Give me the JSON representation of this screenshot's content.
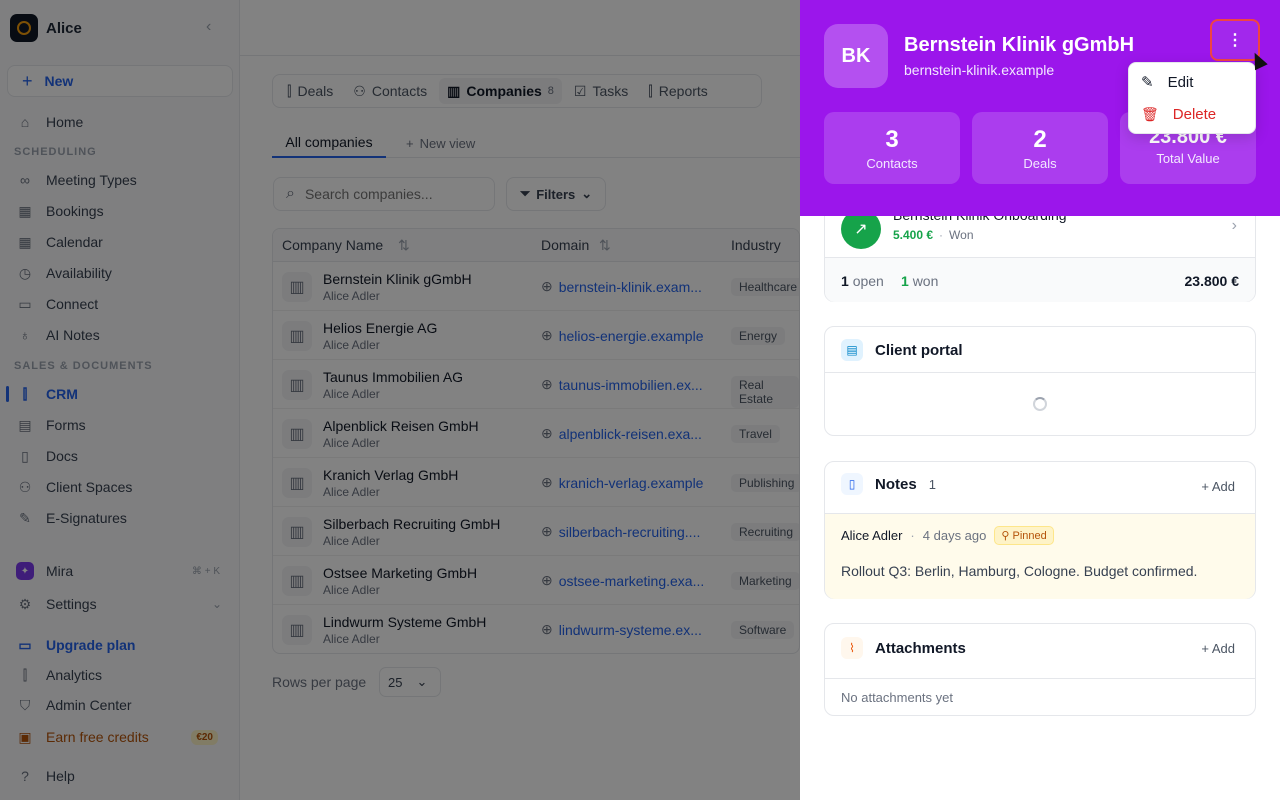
{
  "sidebar": {
    "workspace": "Alice",
    "new_label": "New",
    "items": [
      {
        "label": "Home"
      },
      {
        "label": "Meeting Types"
      },
      {
        "label": "Bookings"
      },
      {
        "label": "Calendar"
      },
      {
        "label": "Availability"
      },
      {
        "label": "Connect"
      },
      {
        "label": "AI Notes"
      },
      {
        "label": "CRM"
      },
      {
        "label": "Forms"
      },
      {
        "label": "Docs"
      },
      {
        "label": "Client Spaces"
      },
      {
        "label": "E-Signatures"
      }
    ],
    "section_scheduling": "SCHEDULING",
    "section_sales": "SALES & DOCUMENTS",
    "mira": "Mira",
    "mira_shortcut": "⌘ + K",
    "settings": "Settings",
    "upgrade": "Upgrade plan",
    "analytics": "Analytics",
    "admin": "Admin Center",
    "credits": "Earn free credits",
    "credits_badge": "€20",
    "help": "Help"
  },
  "main": {
    "tabs": [
      {
        "label": "Deals"
      },
      {
        "label": "Contacts"
      },
      {
        "label": "Companies",
        "count": "8"
      },
      {
        "label": "Tasks"
      },
      {
        "label": "Reports"
      }
    ],
    "view_all": "All companies",
    "new_view": "New view",
    "search_placeholder": "Search companies...",
    "filters_label": "Filters",
    "columns": [
      "Company Name",
      "Domain",
      "Industry"
    ],
    "rows": [
      {
        "name": "Bernstein Klinik gGmbH",
        "owner": "Alice Adler",
        "domain": "bernstein-klinik.exam...",
        "industry": "Healthcare"
      },
      {
        "name": "Helios Energie AG",
        "owner": "Alice Adler",
        "domain": "helios-energie.example",
        "industry": "Energy"
      },
      {
        "name": "Taunus Immobilien AG",
        "owner": "Alice Adler",
        "domain": "taunus-immobilien.ex...",
        "industry": "Real Estate"
      },
      {
        "name": "Alpenblick Reisen GmbH",
        "owner": "Alice Adler",
        "domain": "alpenblick-reisen.exa...",
        "industry": "Travel"
      },
      {
        "name": "Kranich Verlag GmbH",
        "owner": "Alice Adler",
        "domain": "kranich-verlag.example",
        "industry": "Publishing"
      },
      {
        "name": "Silberbach Recruiting GmbH",
        "owner": "Alice Adler",
        "domain": "silberbach-recruiting....",
        "industry": "Recruiting"
      },
      {
        "name": "Ostsee Marketing GmbH",
        "owner": "Alice Adler",
        "domain": "ostsee-marketing.exa...",
        "industry": "Marketing"
      },
      {
        "name": "Lindwurm Systeme GmbH",
        "owner": "Alice Adler",
        "domain": "lindwurm-systeme.ex...",
        "industry": "Software"
      }
    ],
    "rows_per_page_label": "Rows per page",
    "rows_per_page_value": "25"
  },
  "panel": {
    "initials": "BK",
    "title": "Bernstein Klinik gGmbH",
    "domain": "bernstein-klinik.example",
    "kebab": "⋮",
    "stats": [
      {
        "value": "3",
        "label": "Contacts"
      },
      {
        "value": "2",
        "label": "Deals"
      },
      {
        "value": "23.800 €",
        "label": "Total Value"
      }
    ],
    "menu": {
      "edit": "Edit",
      "delete": "Delete"
    },
    "deal": {
      "name": "Bernstein Klinik Onboarding",
      "amount": "5.400 €",
      "sep": "·",
      "status": "Won"
    },
    "deal_summary": {
      "open_count": "1",
      "open_label": "open",
      "won_count": "1",
      "won_label": "won",
      "total": "23.800 €"
    },
    "portal_title": "Client portal",
    "notes_title": "Notes",
    "notes_count": "1",
    "add_label": "Add",
    "note": {
      "author": "Alice Adler",
      "sep": "·",
      "time": "4 days ago",
      "pinned": "Pinned",
      "text": "Rollout Q3: Berlin, Hamburg, Cologne. Budget confirmed."
    },
    "attachments_title": "Attachments",
    "attachments_empty": "No attachments yet"
  },
  "colors": {
    "accent": "#2563eb",
    "panel_header": "#9b16eb",
    "danger": "#dc2626",
    "won": "#16a34a"
  }
}
